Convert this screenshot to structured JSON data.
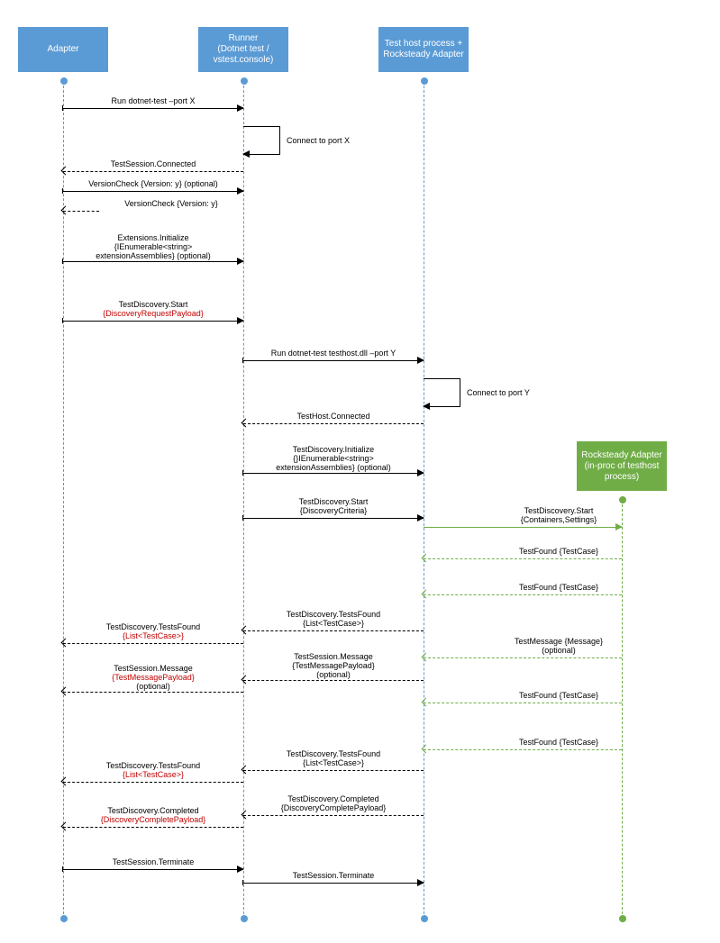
{
  "actors": {
    "adapter": "Adapter",
    "runner": "Runner\n(Dotnet test /\nvstest.console)",
    "testhost": "Test host process +\nRocksteady Adapter",
    "rocksteady": "Rocksteady Adapter\n(in-proc of testhost\nprocess)"
  },
  "messages": {
    "m1": "Run dotnet-test –port X",
    "m2": "Connect to port X",
    "m3": "TestSession.Connected",
    "m4": "VersionCheck {Version: y}  (optional)",
    "m5": "VersionCheck {Version: y}",
    "m6": {
      "l1": "Extensions.Initialize",
      "l2": "{IEnumerable<string>",
      "l3": "extensionAssemblies} (optional)"
    },
    "m7": {
      "l1": "TestDiscovery.Start",
      "l2": "{DiscoveryRequestPayload}"
    },
    "m8": "Run dotnet-test testhost.dll –port Y",
    "m9": "Connect to port Y",
    "m10": "TestHost.Connected",
    "m11": {
      "l1": "TestDiscovery.Initialize",
      "l2": "{}IEnumerable<string>",
      "l3": "extensionAssemblies} (optional)"
    },
    "m12": {
      "l1": "TestDiscovery.Start",
      "l2": "{DiscoveryCriteria}"
    },
    "m13": {
      "l1": "TestDiscovery.Start",
      "l2": "{Containers,Settings}"
    },
    "m14": "TestFound {TestCase}",
    "m15": "TestFound {TestCase}",
    "m16": {
      "l1": "TestDiscovery.TestsFound",
      "l2": "{List<TestCase>}"
    },
    "m17": {
      "l1": "TestDiscovery.TestsFound",
      "l2": "{List<TestCase>}"
    },
    "m18": {
      "l1": "TestMessage {Message}",
      "l2": "(optional)"
    },
    "m19": {
      "l1": "TestSession.Message",
      "l2": "{TestMessagePayload}",
      "l3": "(optional)"
    },
    "m20": {
      "l1": "TestSession.Message",
      "l2": "{TestMessagePayload}",
      "l3": "(optional)"
    },
    "m21": "TestFound {TestCase}",
    "m22": "TestFound {TestCase}",
    "m23": {
      "l1": "TestDiscovery.TestsFound",
      "l2": "{List<TestCase>}"
    },
    "m24": {
      "l1": "TestDiscovery.TestsFound",
      "l2": "{List<TestCase>}"
    },
    "m25": {
      "l1": "TestDiscovery.Completed",
      "l2": "{DiscoveryCompletePayload}"
    },
    "m26": {
      "l1": "TestDiscovery.Completed",
      "l2": "{DiscoveryCompletePayload}"
    },
    "m27": "TestSession.Terminate",
    "m28": "TestSession.Terminate"
  }
}
